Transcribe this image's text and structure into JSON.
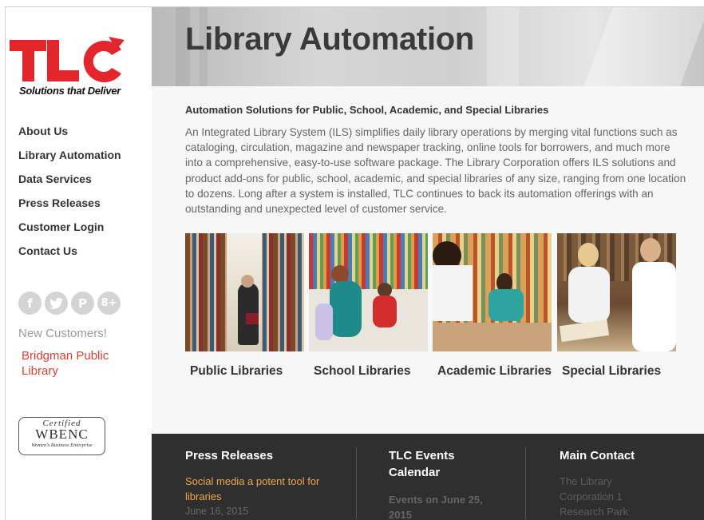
{
  "logo": {
    "text": "TLC",
    "tagline": "Solutions that Deliver",
    "brand_color": "#e3262b"
  },
  "nav": {
    "items": [
      {
        "label": "About Us"
      },
      {
        "label": "Library Automation"
      },
      {
        "label": "Data Services"
      },
      {
        "label": "Press Releases"
      },
      {
        "label": "Customer Login"
      },
      {
        "label": "Contact Us"
      }
    ]
  },
  "social": {
    "icons": [
      {
        "name": "facebook-icon",
        "glyph": "f"
      },
      {
        "name": "twitter-icon",
        "glyph": "t"
      },
      {
        "name": "pinterest-icon",
        "glyph": "P"
      },
      {
        "name": "google-plus-icon",
        "glyph": "8+"
      }
    ]
  },
  "sidebar": {
    "new_customers_label": "New Customers!",
    "new_customer_link": "Bridgman Public Library",
    "badge": {
      "certified": "Certified",
      "name": "WBENC",
      "subtitle": "Women's Business Enterprise"
    }
  },
  "hero": {
    "title": "Library Automation"
  },
  "main": {
    "subhead": "Automation Solutions for Public, School, Academic, and Special Libraries",
    "intro": "An Integrated Library System (ILS) simplifies daily library operations by merging vital functions such as cataloging, circulation, magazine and newspaper tracking, online tools for borrowers, and much more into a comprehensive, easy-to-use software package.  The Library Corporation offers ILS solutions and product add-ons for public, school, academic, and special libraries of any size, ranging from one location to dozens. Long after a system is installed, TLC continues to back its automation offerings with an outstanding and unexpected level of customer service.",
    "cards": [
      {
        "label": "Public Libraries"
      },
      {
        "label": "School Libraries"
      },
      {
        "label": "Academic Libraries"
      },
      {
        "label": "Special Libraries"
      }
    ]
  },
  "footer": {
    "press": {
      "heading": "Press Releases",
      "link": "Social media a potent tool for libraries",
      "date": "June 16, 2015"
    },
    "events": {
      "heading": "TLC Events Calendar",
      "event": "Events on June 25, 2015"
    },
    "contact": {
      "heading": "Main Contact",
      "address": "The Library Corporation 1 Research Park"
    }
  },
  "colors": {
    "accent_red": "#e33b2d",
    "link_orange": "#f0a64a",
    "footer_bg": "#2f2f2f"
  }
}
